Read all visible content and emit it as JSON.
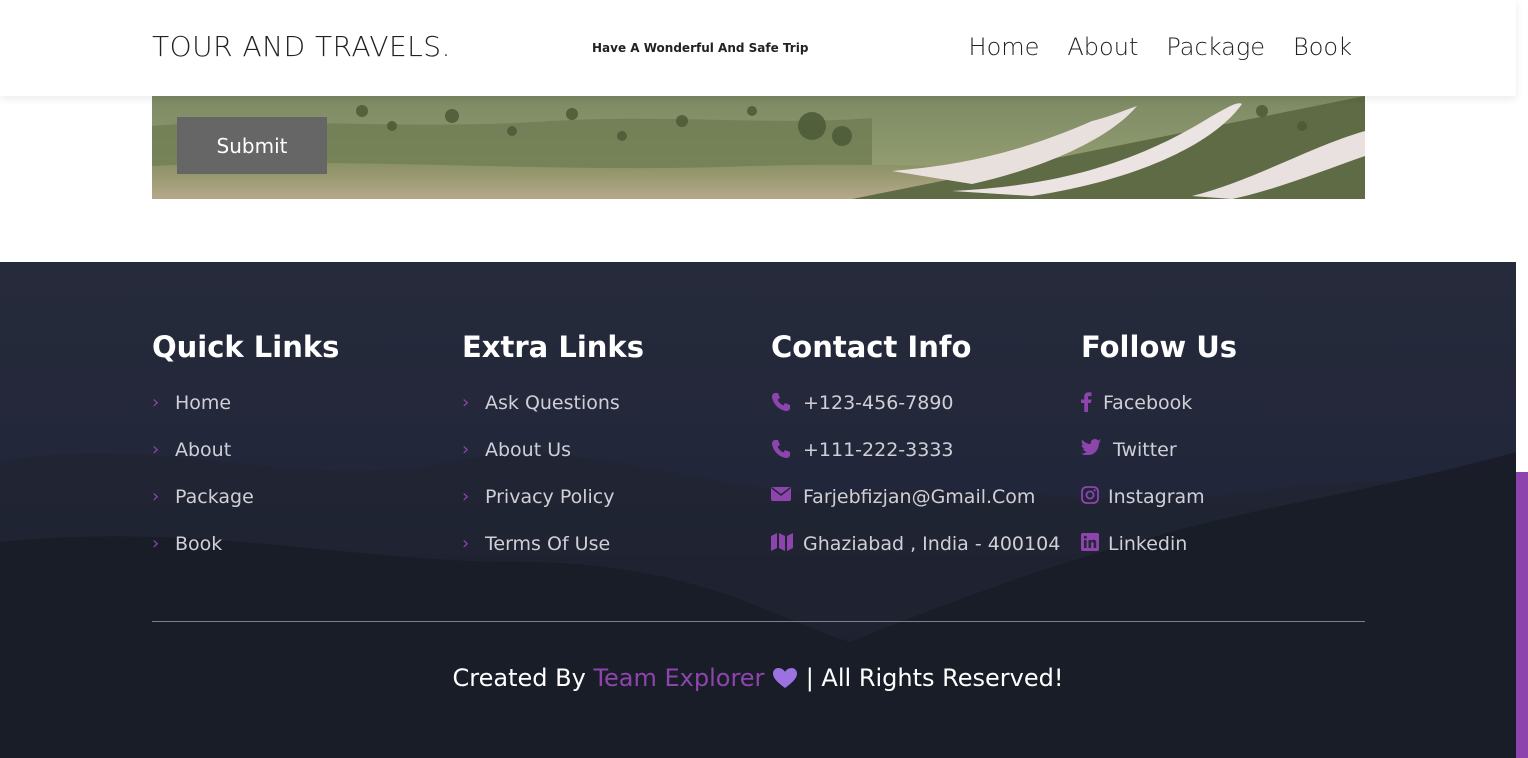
{
  "header": {
    "brand": "TOUR AND TRAVELS.",
    "tagline": "Have A Wonderful And Safe Trip",
    "nav": [
      "Home",
      "About",
      "Package",
      "Book"
    ]
  },
  "banner": {
    "submit_label": "Submit"
  },
  "footer": {
    "quick_links": {
      "title": "Quick Links",
      "items": [
        "Home",
        "About",
        "Package",
        "Book"
      ]
    },
    "extra_links": {
      "title": "Extra Links",
      "items": [
        "Ask Questions",
        "About Us",
        "Privacy Policy",
        "Terms Of Use"
      ]
    },
    "contact_info": {
      "title": "Contact Info",
      "items": [
        {
          "icon": "phone-icon",
          "text": "+123-456-7890"
        },
        {
          "icon": "phone-icon",
          "text": "+111-222-3333"
        },
        {
          "icon": "envelope-icon",
          "text": "Farjebfizjan@Gmail.Com"
        },
        {
          "icon": "map-icon",
          "text": "Ghaziabad , India - 400104"
        }
      ]
    },
    "follow_us": {
      "title": "Follow Us",
      "items": [
        {
          "icon": "facebook-icon",
          "text": "Facebook"
        },
        {
          "icon": "twitter-icon",
          "text": "Twitter"
        },
        {
          "icon": "instagram-icon",
          "text": "Instagram"
        },
        {
          "icon": "linkedin-icon",
          "text": "Linkedin"
        }
      ]
    },
    "credit": {
      "prefix": "Created By",
      "team": "Team Explorer",
      "suffix": "| All Rights Reserved!"
    }
  },
  "colors": {
    "accent": "#8e44ad",
    "footer_bg": "#242839",
    "footer_text": "#cfd0d6",
    "submit_bg": "#666666"
  }
}
